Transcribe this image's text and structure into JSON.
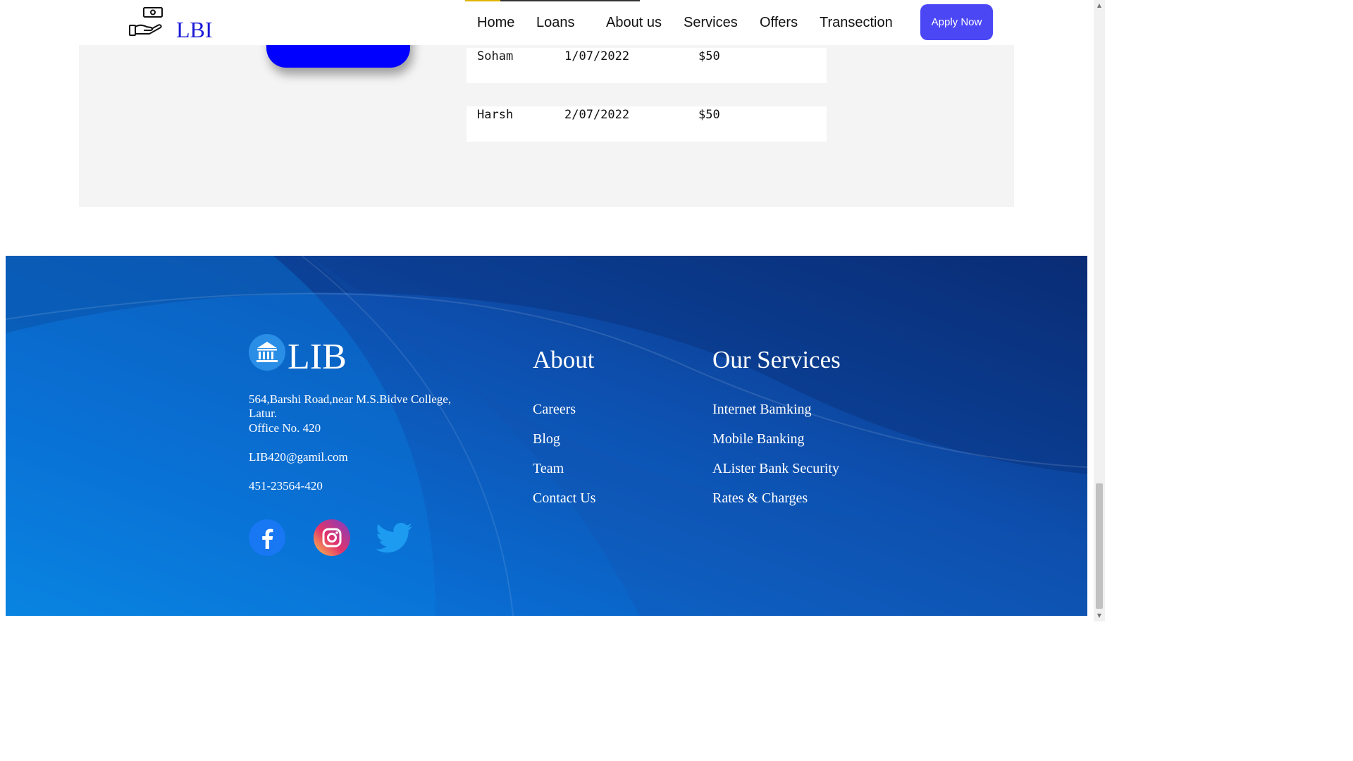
{
  "header": {
    "logo_text": "LBI",
    "nav": [
      "Home",
      "Loans",
      "About us",
      "Services",
      "Offers",
      "Transection"
    ],
    "apply_label": "Apply Now",
    "apply_color": "#4b47f5"
  },
  "transactions": [
    {
      "name": "Soham",
      "date": "1/07/2022",
      "amount": "$50"
    },
    {
      "name": "Harsh",
      "date": "2/07/2022",
      "amount": "$50"
    }
  ],
  "footer": {
    "brand": "LIB",
    "address_line1": "564,Barshi Road,near M.S.Bidve College,",
    "address_line2": "Latur.",
    "office": "Office No. 420",
    "email": "LIB420@gamil.com",
    "phone": "451-23564-420",
    "about_heading": "About",
    "about_links": [
      "Careers",
      "Blog",
      "Team",
      "Contact Us"
    ],
    "services_heading": "Our Services",
    "services_links": [
      "Internet Bamking",
      "Mobile Banking",
      "ALister Bank Security",
      "Rates & Charges"
    ],
    "social_icons": [
      "facebook-icon",
      "instagram-icon",
      "twitter-icon"
    ]
  }
}
